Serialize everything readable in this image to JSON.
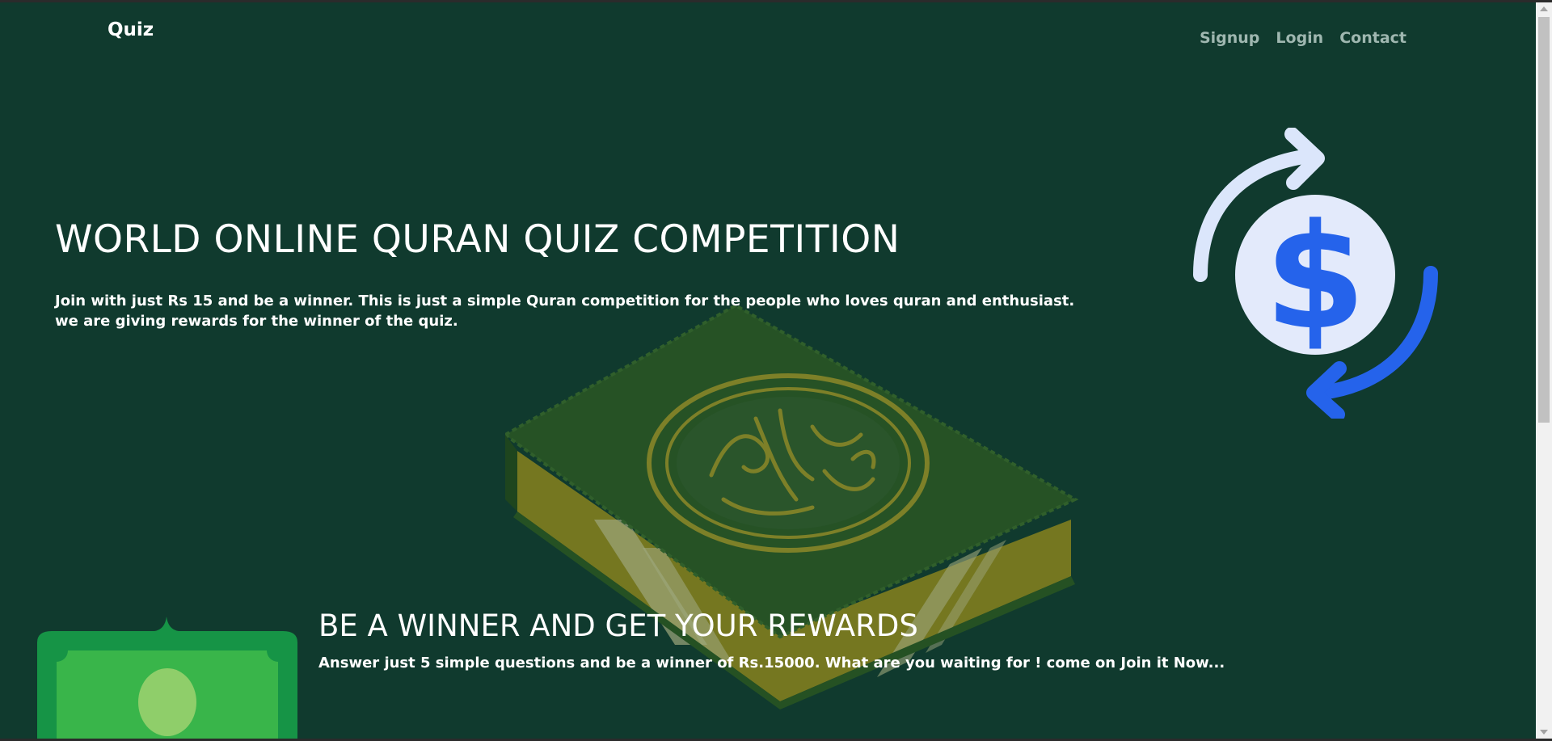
{
  "nav": {
    "brand": "Quiz",
    "links": [
      "Signup",
      "Login",
      "Contact"
    ]
  },
  "hero": {
    "title": "WORLD ONLINE QURAN QUIZ COMPETITION",
    "description": "Join with just Rs 15 and be a winner. This is just a simple Quran competition for the people who loves quran and enthusiast. we are giving rewards for the winner of the quiz."
  },
  "reward": {
    "title": "BE A WINNER AND GET YOUR REWARDS",
    "text_before": "Answer just 5 simple questions and be a winner of ",
    "amount": "Rs.15000",
    "text_after": ". What are you waiting for ! come on Join it Now..."
  },
  "icons": {
    "money_exchange": "dollar-exchange-icon",
    "quran_book": "quran-book-illustration",
    "cash": "banknote-icon"
  },
  "colors": {
    "background": "#103a2e",
    "accent_blue": "#2563eb",
    "light_blue": "#dbe6fb",
    "book_green": "#2e5a1f",
    "gold": "#b9a22a",
    "cash_green": "#17a34a"
  }
}
